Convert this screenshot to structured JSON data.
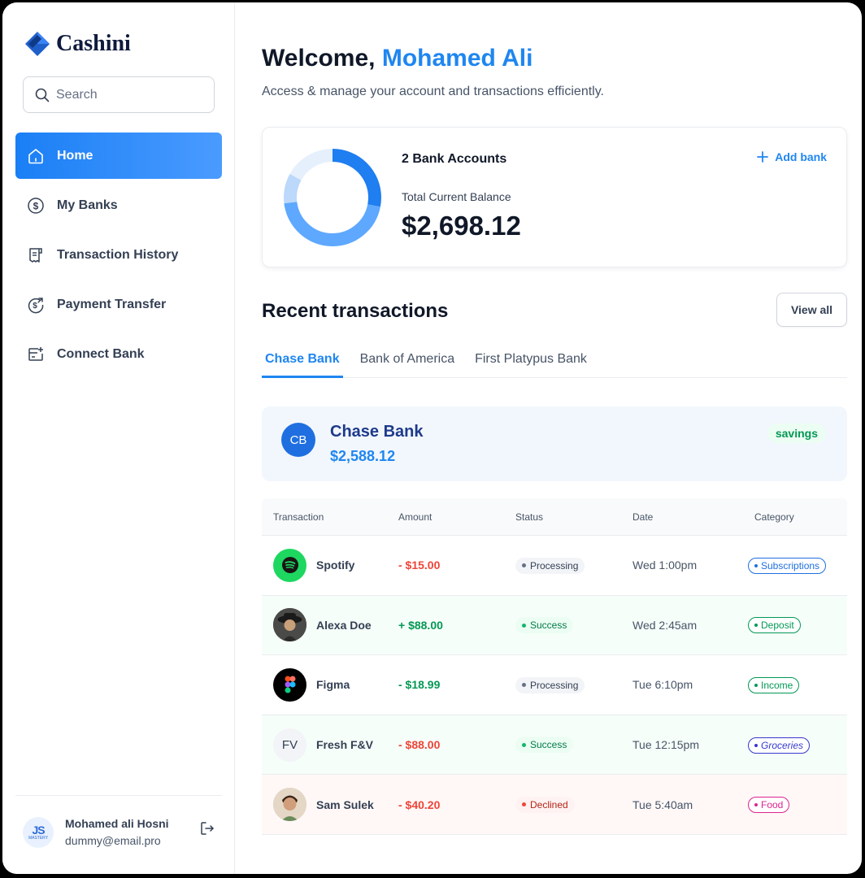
{
  "sidebar": {
    "logo_text": "Cashini",
    "search_placeholder": "Search",
    "nav": [
      {
        "label": "Home",
        "icon": "home-icon",
        "active": true
      },
      {
        "label": "My Banks",
        "icon": "dollar-circle-icon"
      },
      {
        "label": "Transaction History",
        "icon": "receipt-icon"
      },
      {
        "label": "Payment Transfer",
        "icon": "money-send-icon"
      },
      {
        "label": "Connect Bank",
        "icon": "card-add-icon"
      }
    ],
    "user": {
      "avatar_text": "JS",
      "avatar_sub": "MASTERY",
      "name": "Mohamed ali Hosni",
      "email": "dummy@email.pro"
    }
  },
  "header": {
    "welcome_prefix": "Welcome,",
    "user_name": "Mohamed Ali",
    "subtitle": "Access & manage your account and transactions efficiently."
  },
  "balance_card": {
    "bank_count_label": "2 Bank Accounts",
    "total_label": "Total Current Balance",
    "total_value": "$2,698.12",
    "add_bank_label": "Add bank",
    "donut_segments": [
      0.28,
      0.45,
      0.1,
      0.17
    ],
    "donut_colors": [
      "#1f7ef0",
      "#5ea8ff",
      "#bcd8fb",
      "#e6f0fd"
    ]
  },
  "recent": {
    "title": "Recent transactions",
    "view_all_label": "View all",
    "tabs": [
      "Chase Bank",
      "Bank of America",
      "First Platypus Bank"
    ],
    "active_tab": 0
  },
  "bank_panel": {
    "initials": "CB",
    "name": "Chase Bank",
    "balance": "$2,588.12",
    "badge": "savings"
  },
  "table": {
    "headers": [
      "Transaction",
      "Amount",
      "Status",
      "Date",
      "Category"
    ],
    "rows": [
      {
        "name": "Spotify",
        "icon": "spotify-logo",
        "amount": "- $15.00",
        "status": "Processing",
        "date": "Wed 1:00pm",
        "category": "Subscriptions",
        "cat_color": "#1f6fe0"
      },
      {
        "name": "Alexa Doe",
        "icon": "alexa-avatar",
        "amount": "+ $88.00",
        "status": "Success",
        "date": "Wed 2:45am",
        "category": "Deposit",
        "cat_color": "#039855"
      },
      {
        "name": "Figma",
        "icon": "figma-logo",
        "amount": "- $18.99",
        "status": "Processing",
        "date": "Tue 6:10pm",
        "category": "Income",
        "cat_color": "#039855"
      },
      {
        "name": "Fresh F&V",
        "icon": "FV",
        "amount": "- $88.00",
        "status": "Success",
        "date": "Tue 12:15pm",
        "category": "Groceries",
        "cat_color": "#3538cd"
      },
      {
        "name": "Sam Sulek",
        "icon": "sam-avatar",
        "amount": "- $40.20",
        "status": "Declined",
        "date": "Tue 5:40am",
        "category": "Food",
        "cat_color": "#dd2590"
      }
    ]
  }
}
